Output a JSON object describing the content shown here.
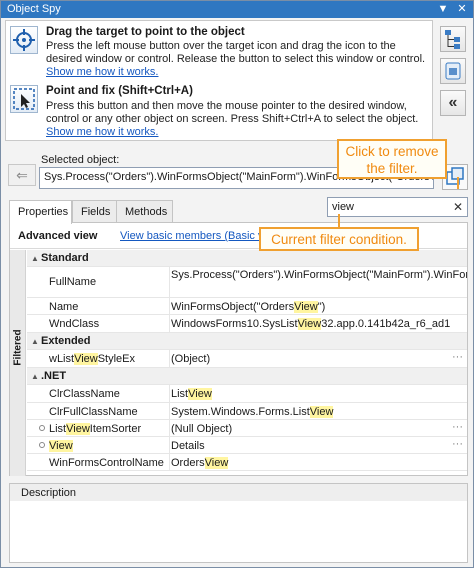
{
  "window": {
    "title": "Object Spy",
    "pin": "▼",
    "close": "✕"
  },
  "drag_tool": {
    "title": "Drag the target to point to the object",
    "desc": "Press the left mouse button over the target icon and drag the icon to the desired window or control. Release the button to select this window or control.",
    "link": "Show me how it works."
  },
  "point_tool": {
    "title": "Point and fix (Shift+Ctrl+A)",
    "desc": "Press this button and then move the mouse pointer to the desired window, control or any other object on screen. Press Shift+Ctrl+A to select the object.",
    "link": "Show me how it works."
  },
  "sidebar": {
    "collapse_label": "«"
  },
  "selected": {
    "label": "Selected object:",
    "value": "Sys.Process(\"Orders\").WinFormsObject(\"MainForm\").WinFormsObject(\"OrdersView\")"
  },
  "tabs": [
    "Properties",
    "Fields",
    "Methods"
  ],
  "filter": {
    "value": "view",
    "clear": "✕"
  },
  "advanced": {
    "title": "Advanced view",
    "link": "View basic members (Basic view)"
  },
  "strip_label": "Filtered",
  "groups": {
    "standard": "Standard",
    "extended": "Extended",
    "net": ".NET"
  },
  "rows": {
    "fullname": {
      "name": "FullName",
      "value": "Sys.Process(\"Orders\").WinFormsObject(\"MainForm\").WinFormsObject(\"OrdersView\")"
    },
    "name": {
      "name": "Name",
      "v1": "WinFormsObject(\"Orders",
      "v2": "View",
      "v3": "\")"
    },
    "wndclass": {
      "name": "WndClass",
      "v1": "WindowsForms10.SysList",
      "v2": "View",
      "v3": "32.app.0.141b42a_r6_ad1"
    },
    "wlist": {
      "n1": "wList",
      "n2": "View",
      "n3": "StyleEx",
      "value": "(Object)",
      "dots": "···"
    },
    "clrclass": {
      "name": "ClrClassName",
      "v1": "List",
      "v2": "View"
    },
    "clrfull": {
      "name": "ClrFullClassName",
      "v1": "System.Windows.Forms.List",
      "v2": "View"
    },
    "sorter": {
      "n1": "List",
      "n2": "View",
      "n3": "ItemSorter",
      "value": "(Null Object)",
      "dots": "···"
    },
    "view": {
      "n1": "View",
      "value": "Details",
      "dots": "···"
    },
    "wfcname": {
      "name": "WinFormsControlName",
      "v1": "Orders",
      "v2": "View"
    }
  },
  "description": {
    "title": "Description"
  },
  "callouts": {
    "remove_filter": "Click to remove the filter.",
    "current_filter": "Current filter condition."
  },
  "colors": {
    "accent": "#2f77c1",
    "callout": "#f0a030",
    "highlight": "#fff5a0",
    "link": "#1558c0"
  }
}
